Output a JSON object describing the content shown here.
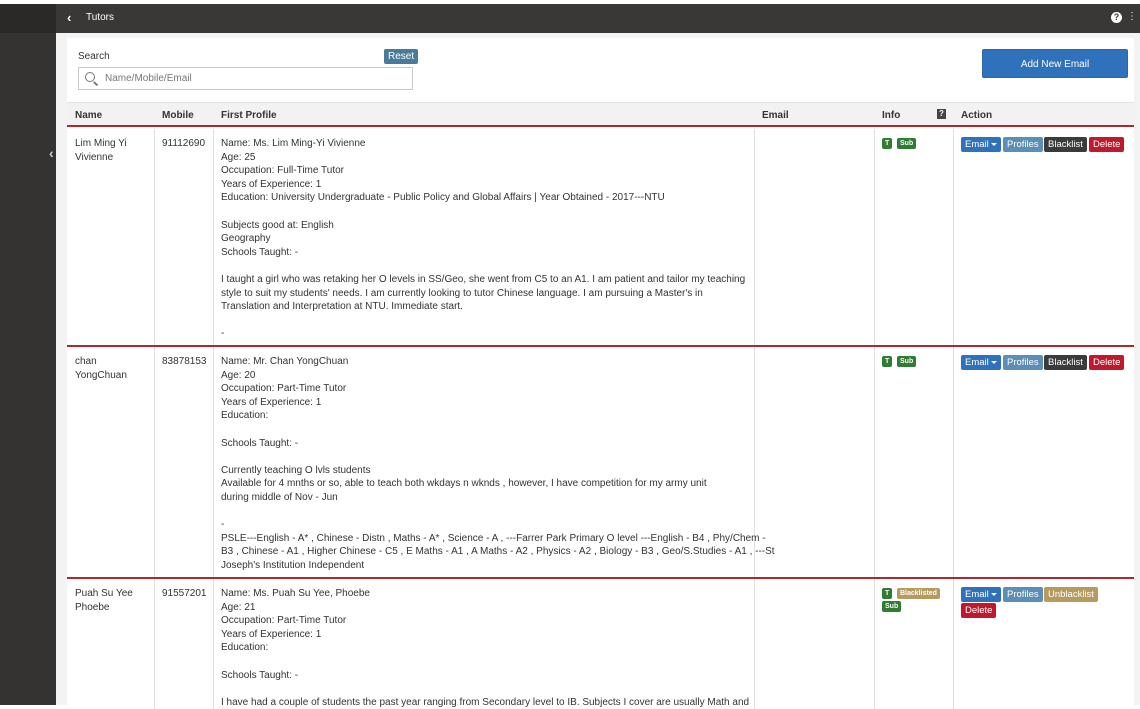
{
  "topbar": {
    "title": "Tutors",
    "back_icon": "chevron-left-icon",
    "help_icon": "question-circle-icon",
    "help_glyph": "?",
    "more_glyph": "⋮"
  },
  "search": {
    "label": "Search",
    "placeholder": "Name/Mobile/Email",
    "reset_label": "Reset"
  },
  "add_button_label": "Add New Email",
  "columns": {
    "name": "Name",
    "mobile": "Mobile",
    "profile": "First Profile",
    "email": "Email",
    "info": "Info",
    "info_help": "?",
    "action": "Action"
  },
  "badges": {
    "t": "T",
    "sub": "Sub",
    "blacklisted": "Blacklisted"
  },
  "actions": {
    "email": "Email",
    "profiles": "Profiles",
    "blacklist": "Blacklist",
    "unblacklist": "Unblacklist",
    "delete": "Delete"
  },
  "rows": [
    {
      "name_line1": "Lim Ming Yi",
      "name_line2": "Vivienne",
      "mobile": "91112690",
      "email": "",
      "profile": [
        "Name: Ms. Lim Ming-Yi Vivienne",
        "Age: 25",
        "Occupation: Full-Time Tutor",
        "Years of Experience: 1",
        "Education: University Undergraduate - Public Policy and Global Affairs | Year Obtained - 2017---NTU",
        "",
        "Subjects good at: English",
        "Geography",
        "Schools Taught: -",
        "",
        "I taught a girl who was retaking her O levels in SS/Geo, she went from C5 to an A1. I am patient and tailor my teaching",
        "style to suit my students' needs. I am currently looking to tutor Chinese language. I am pursuing a Master's in",
        "Translation and Interpretation at NTU. Immediate start.",
        "",
        "-"
      ]
    },
    {
      "name_line1": "chan",
      "name_line2": "YongChuan",
      "mobile": "83878153",
      "email": "",
      "profile": [
        "Name: Mr. Chan YongChuan",
        "Age: 20",
        "Occupation: Part-Time Tutor",
        "Years of Experience: 1",
        "Education:",
        "",
        "Schools Taught: -",
        "",
        "Currently teaching O lvls students",
        "Available for 4 mnths or so, able to teach both wkdays n wknds , however, I have competition for my army unit",
        "during middle of Nov - Jun",
        "",
        "-",
        "PSLE---English - A* , Chinese - Distn , Maths - A* , Science - A , ---Farrer Park Primary O level ---English - B4 , Phy/Chem -",
        "B3 , Chinese - A1 , Higher Chinese - C5 , E Maths - A1 , A Maths - A2 , Physics - A2 , Biology - B3 , Geo/S.Studies - A1 , ---St",
        "Joseph's Institution Independent"
      ]
    },
    {
      "name_line1": "Puah Su Yee",
      "name_line2": "Phoebe",
      "mobile": "91557201",
      "email": "",
      "profile": [
        "Name: Ms. Puah Su Yee, Phoebe",
        "Age: 21",
        "Occupation: Part-Time Tutor",
        "Years of Experience: 1",
        "Education:",
        "",
        "Schools Taught: -",
        "",
        "I have had a couple of students the past year ranging from Secondary level to IB. Subjects I cover are usually Math and"
      ]
    }
  ]
}
